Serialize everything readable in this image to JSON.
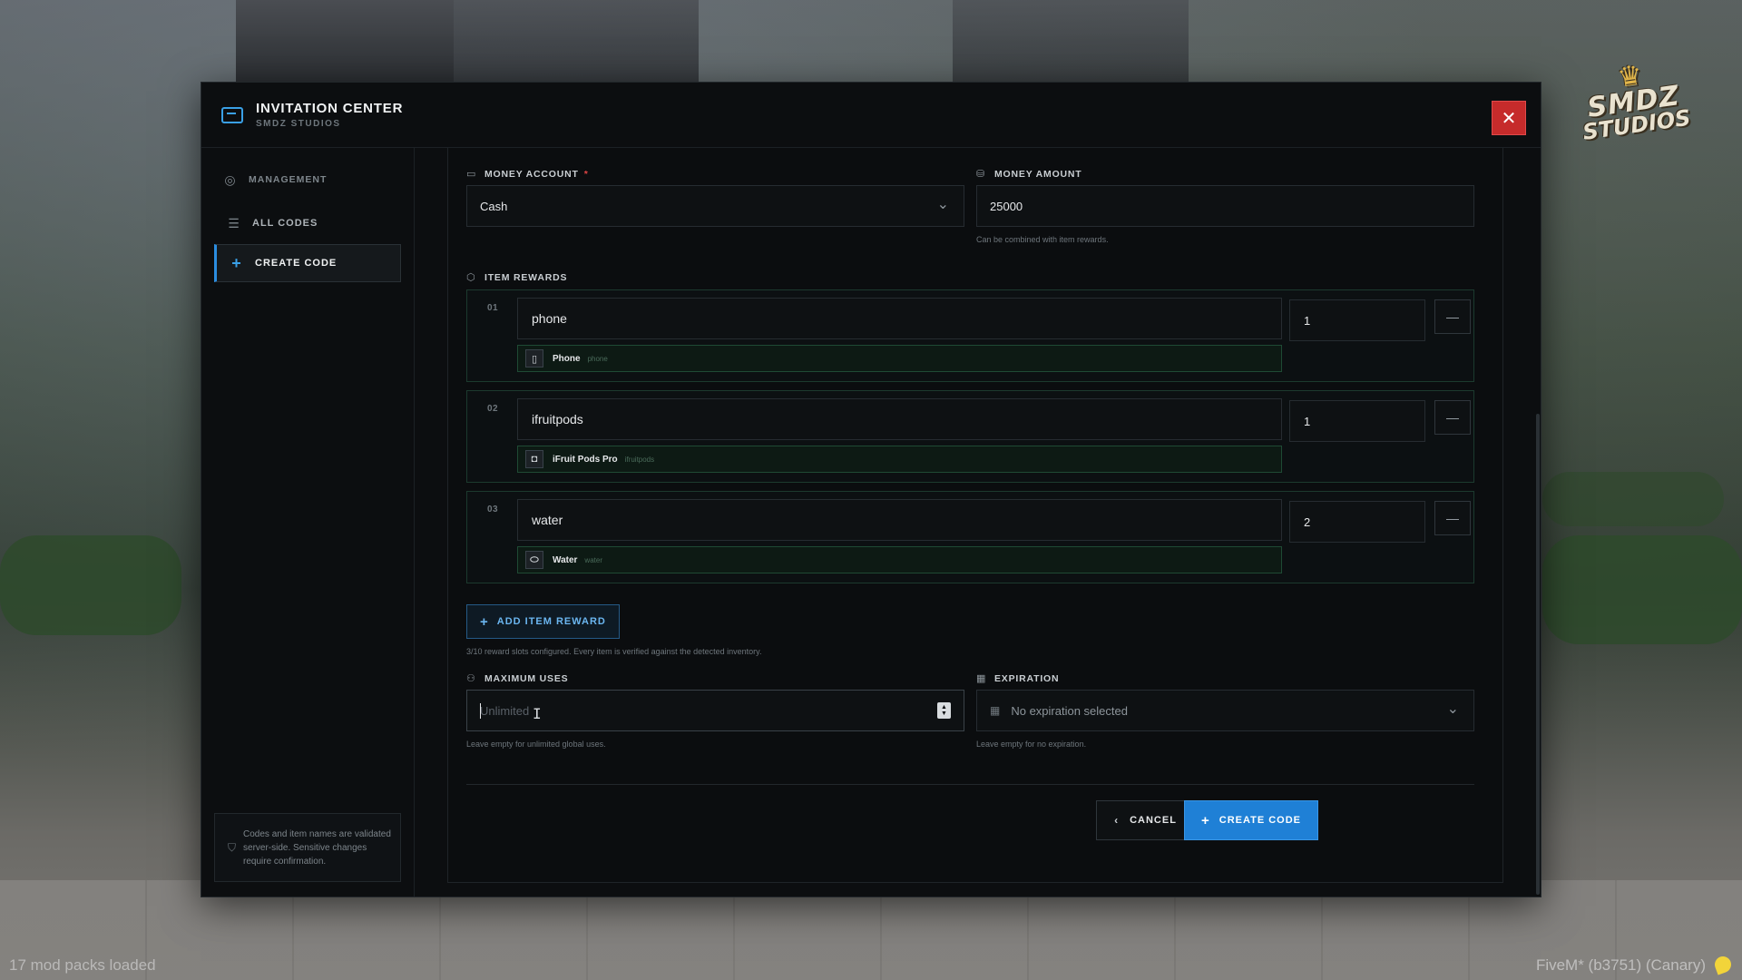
{
  "watermark": {
    "line1": "SMDZ",
    "line2": "STUDIOS"
  },
  "footer": {
    "mods": "17 mod packs loaded",
    "build": "FiveM* (b3751) (Canary)"
  },
  "window": {
    "title": "INVITATION CENTER",
    "subtitle": "SMDZ STUDIOS",
    "close_label": "✕"
  },
  "sidebar": {
    "section": "MANAGEMENT",
    "items": [
      {
        "label": "ALL CODES"
      },
      {
        "label": "CREATE CODE"
      }
    ],
    "note": "Codes and item names are validated server-side. Sensitive changes require confirmation."
  },
  "form": {
    "money_account": {
      "label": "MONEY ACCOUNT",
      "required": "*",
      "value": "Cash"
    },
    "money_amount": {
      "label": "MONEY AMOUNT",
      "value": "25000",
      "hint": "Can be combined with item rewards."
    },
    "item_rewards": {
      "label": "ITEM REWARDS",
      "items": [
        {
          "num": "01",
          "name": "phone",
          "match_label": "Phone",
          "match_id": "phone",
          "qty": "1",
          "icon": "phone-icon"
        },
        {
          "num": "02",
          "name": "ifruitpods",
          "match_label": "iFruit Pods Pro",
          "match_id": "ifruitpods",
          "qty": "1",
          "icon": "earbuds-icon"
        },
        {
          "num": "03",
          "name": "water",
          "match_label": "Water",
          "match_id": "water",
          "qty": "2",
          "icon": "bottle-icon"
        }
      ],
      "add_label": "ADD ITEM REWARD",
      "status": "3/10 reward slots configured. Every item is verified against the detected inventory."
    },
    "max_uses": {
      "label": "MAXIMUM USES",
      "placeholder": "Unlimited",
      "hint": "Leave empty for unlimited global uses."
    },
    "expiration": {
      "label": "EXPIRATION",
      "placeholder": "No expiration selected",
      "hint": "Leave empty for no expiration."
    },
    "actions": {
      "cancel": "CANCEL",
      "create": "CREATE CODE"
    }
  },
  "colors": {
    "accent": "#1f80d6",
    "danger": "#c62b2b",
    "success_border": "#1f4a34"
  }
}
